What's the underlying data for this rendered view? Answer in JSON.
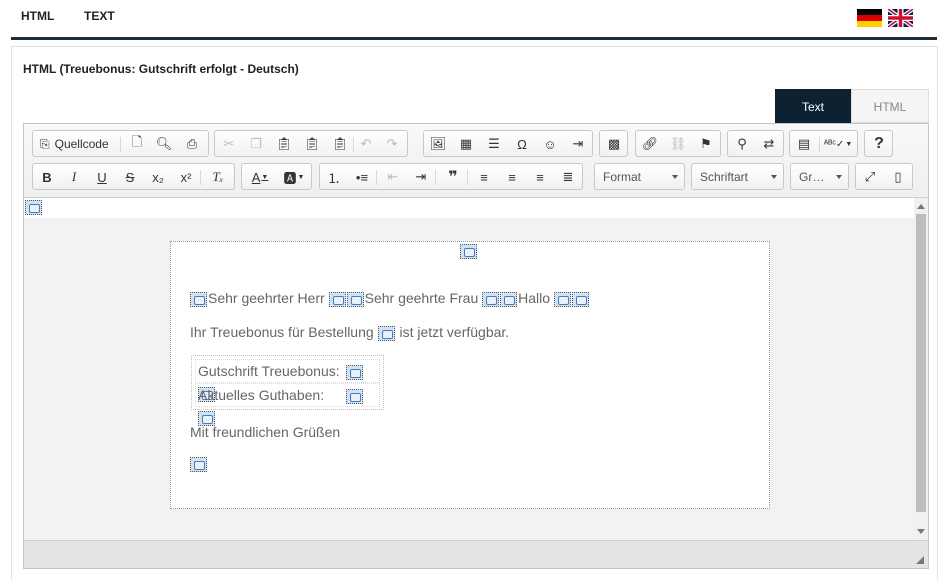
{
  "top_tabs": {
    "html": "HTML",
    "text": "TEXT"
  },
  "languages": [
    "de",
    "en"
  ],
  "panel": {
    "title": "HTML (Treuebonus: Gutschrift erfolgt - Deutsch)",
    "mode_tabs": {
      "text": "Text",
      "html": "HTML"
    },
    "active_mode": "Text"
  },
  "toolbar": {
    "source_label": "Quellcode",
    "format_label": "Format",
    "font_label": "Schriftart",
    "size_label": "Gr…",
    "help_label": "?"
  },
  "email": {
    "greeting_herr": "Sehr geehrter Herr",
    "greeting_frau": "Sehr geehrte Frau",
    "greeting_hallo": "Hallo",
    "line1_before": "Ihr Treuebonus für Bestellung",
    "line1_after": "ist jetzt verfügbar.",
    "row1_label": "Gutschrift Treuebonus:",
    "row2_label": "Aktuelles Guthaben:",
    "closing": "Mit freundlichen Grüßen"
  },
  "colors": {
    "accent_dark": "#0c2233",
    "rule": "#1c2e3b",
    "placeholder_bg": "#cfe3f5"
  }
}
